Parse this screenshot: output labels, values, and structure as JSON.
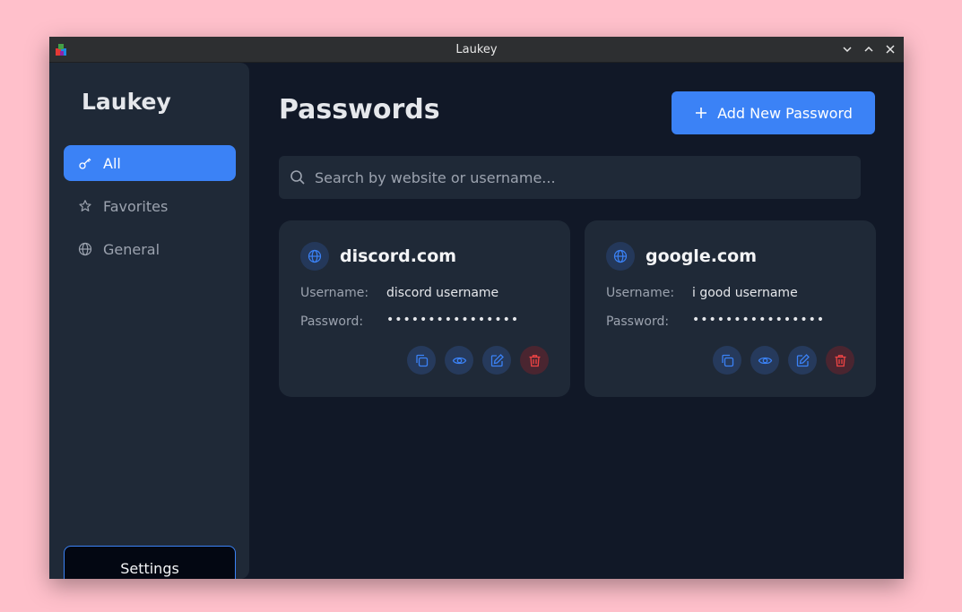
{
  "window": {
    "title": "Laukey"
  },
  "sidebar": {
    "brand": "Laukey",
    "items": [
      {
        "label": "All",
        "icon": "key-icon",
        "active": true
      },
      {
        "label": "Favorites",
        "icon": "star-icon",
        "active": false
      },
      {
        "label": "General",
        "icon": "globe-icon",
        "active": false
      }
    ],
    "settings_label": "Settings"
  },
  "main": {
    "title": "Passwords",
    "add_button_label": "Add New Password",
    "search": {
      "placeholder": "Search by website or username...",
      "value": ""
    },
    "cards": [
      {
        "site": "discord.com",
        "username_label": "Username:",
        "username": "discord username",
        "password_label": "Password:",
        "password_mask": "••••••••••••••••"
      },
      {
        "site": "google.com",
        "username_label": "Username:",
        "username": "i good username",
        "password_label": "Password:",
        "password_mask": "••••••••••••••••"
      }
    ]
  },
  "colors": {
    "accent": "#3b82f6",
    "danger": "#ef4444",
    "background": "#111827",
    "surface": "#1f2937"
  }
}
